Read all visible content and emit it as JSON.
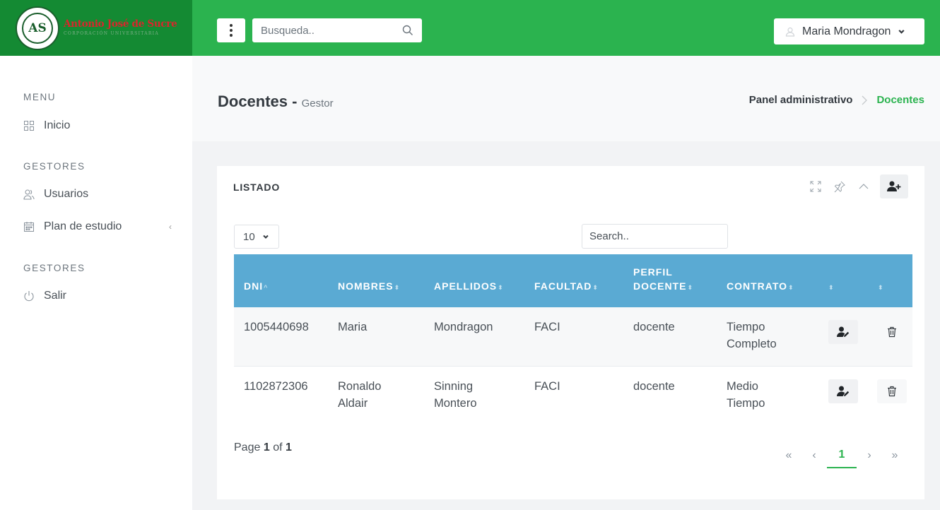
{
  "brand": {
    "logo_text": "AS",
    "name": "Antonio José de Sucre",
    "subtitle": "CORPORACIÓN UNIVERSITARIA"
  },
  "header": {
    "search_placeholder": "Busqueda..",
    "user_name": "Maria Mondragon"
  },
  "sidebar": {
    "sections": [
      {
        "title": "MENU",
        "items": [
          {
            "label": "Inicio",
            "icon": "grid-icon"
          }
        ]
      },
      {
        "title": "GESTORES",
        "items": [
          {
            "label": "Usuarios",
            "icon": "users-icon"
          },
          {
            "label": "Plan de estudio",
            "icon": "calendar-icon",
            "chevron": "‹"
          }
        ]
      },
      {
        "title": "GESTORES",
        "items": [
          {
            "label": "Salir",
            "icon": "power-icon"
          }
        ]
      }
    ]
  },
  "page": {
    "title": "Docentes",
    "title_sep": " - ",
    "subtitle": "Gestor",
    "breadcrumb": [
      "Panel administrativo",
      "Docentes"
    ]
  },
  "card": {
    "title": "LISTADO",
    "page_length": "10",
    "search_placeholder": "Search..",
    "columns": [
      {
        "label": "DNI",
        "sort": "^"
      },
      {
        "label": "NOMBRES",
        "sort": "⬍"
      },
      {
        "label": "APELLIDOS",
        "sort": "⬍"
      },
      {
        "label": "FACULTAD",
        "sort": "⬍"
      },
      {
        "label_line1": "PERFIL",
        "label": "DOCENTE",
        "sort": "⬍"
      },
      {
        "label": "CONTRATO",
        "sort": "⬍"
      },
      {
        "label": "",
        "sort": "⬍"
      },
      {
        "label": "",
        "sort": "⬍"
      }
    ],
    "rows": [
      {
        "dni": "1005440698",
        "nombres": [
          "Maria"
        ],
        "apellidos": [
          "Mondragon"
        ],
        "facultad": "FACI",
        "perfil": "docente",
        "contrato": [
          "Tiempo",
          "Completo"
        ]
      },
      {
        "dni": "1102872306",
        "nombres": [
          "Ronaldo",
          "Aldair"
        ],
        "apellidos": [
          "Sinning",
          "Montero"
        ],
        "facultad": "FACI",
        "perfil": "docente",
        "contrato": [
          "Medio",
          "Tiempo"
        ]
      }
    ],
    "pagination": {
      "page_label": "Page",
      "current": "1",
      "of_label": "of",
      "total": "1",
      "first": "«",
      "prev": "‹",
      "next": "›",
      "last": "»"
    }
  },
  "colors": {
    "header_green": "#2bb34f",
    "brand_green": "#148a33",
    "table_head": "#5aaad3",
    "accent": "#2bb34f"
  }
}
